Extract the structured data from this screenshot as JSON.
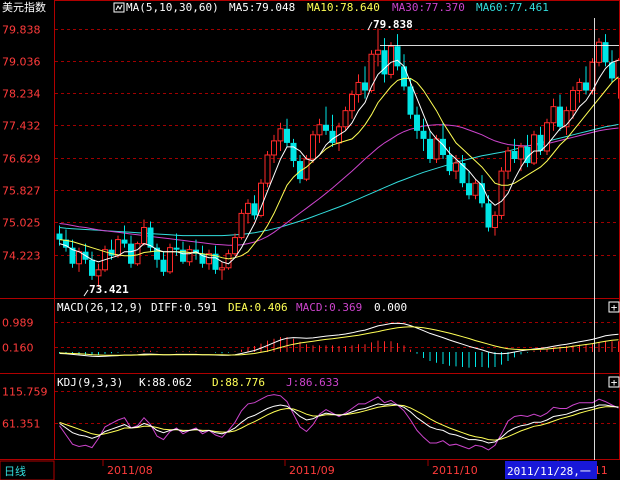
{
  "header": {
    "title": "美元指数",
    "ma_params": "MA(5,10,30,60)",
    "ma5": "MA5:79.048",
    "ma10": "MA10:78.640",
    "ma30": "MA30:77.370",
    "ma60": "MA60:77.461"
  },
  "macd_header": {
    "params": "MACD(26,12,9)",
    "diff": "DIFF:0.591",
    "dea": "DEA:0.406",
    "macd": "MACD:0.369",
    "extra": "0.000"
  },
  "kdj_header": {
    "params": "KDJ(9,3,3)",
    "k": "K:88.062",
    "d": "D:88.776",
    "j": "J:86.633"
  },
  "period_tab": "日线",
  "cursor_date": "2011/11/28,一",
  "price_high_label": "79.838",
  "price_low_label": "73.421",
  "price_axis": [
    "79.838",
    "79.036",
    "78.234",
    "77.432",
    "76.629",
    "75.827",
    "75.025",
    "74.223"
  ],
  "macd_axis": [
    "0.989",
    "0.160"
  ],
  "kdj_axis": [
    "115.759",
    "61.351"
  ],
  "date_axis": [
    "2011/08",
    "2011/09",
    "2011/10",
    "2011/11"
  ],
  "colors": {
    "up": "#ff2a2a",
    "down": "#00e5e5",
    "ma5": "#ffffff",
    "ma10": "#ffff55",
    "ma30": "#cc44cc",
    "ma60": "#33dddd",
    "grid": "#a00000",
    "axis_text": "#ff3b3b"
  },
  "chart_data": {
    "type": "candlestick",
    "ylim": [
      73.2,
      80.1
    ],
    "candles": [
      [
        74.75,
        74.95,
        74.45,
        74.6
      ],
      [
        74.6,
        74.85,
        74.3,
        74.4
      ],
      [
        74.4,
        74.6,
        73.9,
        74.0
      ],
      [
        74.0,
        74.4,
        73.8,
        74.3
      ],
      [
        74.3,
        74.5,
        74.0,
        74.1
      ],
      [
        74.1,
        74.3,
        73.6,
        73.7
      ],
      [
        73.7,
        74.0,
        73.42,
        73.85
      ],
      [
        73.85,
        74.45,
        73.8,
        74.35
      ],
      [
        74.35,
        74.6,
        74.1,
        74.2
      ],
      [
        74.2,
        74.7,
        74.15,
        74.6
      ],
      [
        74.6,
        74.95,
        74.4,
        74.5
      ],
      [
        74.5,
        74.7,
        73.9,
        74.0
      ],
      [
        74.0,
        74.55,
        73.95,
        74.5
      ],
      [
        74.5,
        75.1,
        74.45,
        74.9
      ],
      [
        74.9,
        75.05,
        74.3,
        74.4
      ],
      [
        74.4,
        74.5,
        73.9,
        74.1
      ],
      [
        74.1,
        74.3,
        73.7,
        73.8
      ],
      [
        73.8,
        74.5,
        73.75,
        74.4
      ],
      [
        74.4,
        74.75,
        74.2,
        74.35
      ],
      [
        74.35,
        74.55,
        74.0,
        74.05
      ],
      [
        74.05,
        74.45,
        73.95,
        74.35
      ],
      [
        74.35,
        74.6,
        74.1,
        74.25
      ],
      [
        74.25,
        74.45,
        73.9,
        74.0
      ],
      [
        74.0,
        74.35,
        73.85,
        74.25
      ],
      [
        74.25,
        74.45,
        73.75,
        73.85
      ],
      [
        73.85,
        74.05,
        73.6,
        73.9
      ],
      [
        73.9,
        74.35,
        73.85,
        74.25
      ],
      [
        74.25,
        74.75,
        74.2,
        74.65
      ],
      [
        74.65,
        75.35,
        74.6,
        75.25
      ],
      [
        75.25,
        75.6,
        75.0,
        75.5
      ],
      [
        75.5,
        75.7,
        75.1,
        75.2
      ],
      [
        75.2,
        76.1,
        75.15,
        76.0
      ],
      [
        76.0,
        76.8,
        75.9,
        76.7
      ],
      [
        76.7,
        77.2,
        76.5,
        77.05
      ],
      [
        77.05,
        77.5,
        76.8,
        77.35
      ],
      [
        77.35,
        77.6,
        76.9,
        77.0
      ],
      [
        77.0,
        77.1,
        76.4,
        76.55
      ],
      [
        76.55,
        76.7,
        76.0,
        76.1
      ],
      [
        76.1,
        76.7,
        76.05,
        76.6
      ],
      [
        76.6,
        77.3,
        76.5,
        77.2
      ],
      [
        77.2,
        77.6,
        77.0,
        77.45
      ],
      [
        77.45,
        77.9,
        77.2,
        77.3
      ],
      [
        77.3,
        77.7,
        76.9,
        77.0
      ],
      [
        77.0,
        77.5,
        76.8,
        77.4
      ],
      [
        77.4,
        77.9,
        77.3,
        77.8
      ],
      [
        77.8,
        78.3,
        77.6,
        78.2
      ],
      [
        78.2,
        78.7,
        78.0,
        78.5
      ],
      [
        78.5,
        78.9,
        78.1,
        78.3
      ],
      [
        78.3,
        79.3,
        78.25,
        79.2
      ],
      [
        79.2,
        79.84,
        78.9,
        79.3
      ],
      [
        79.3,
        79.6,
        78.5,
        78.7
      ],
      [
        78.7,
        79.5,
        78.6,
        79.4
      ],
      [
        79.4,
        79.7,
        78.8,
        78.9
      ],
      [
        78.9,
        79.2,
        78.3,
        78.4
      ],
      [
        78.4,
        78.6,
        77.6,
        77.7
      ],
      [
        77.7,
        77.9,
        77.1,
        77.3
      ],
      [
        77.3,
        77.6,
        76.8,
        77.1
      ],
      [
        77.1,
        77.3,
        76.5,
        76.6
      ],
      [
        76.6,
        77.2,
        76.5,
        77.1
      ],
      [
        77.1,
        77.5,
        76.6,
        76.7
      ],
      [
        76.7,
        76.9,
        76.2,
        76.3
      ],
      [
        76.3,
        76.7,
        76.1,
        76.5
      ],
      [
        76.5,
        76.7,
        75.9,
        76.0
      ],
      [
        76.0,
        76.3,
        75.6,
        75.7
      ],
      [
        75.7,
        76.1,
        75.6,
        76.0
      ],
      [
        76.0,
        76.2,
        75.4,
        75.5
      ],
      [
        75.5,
        75.7,
        74.8,
        74.9
      ],
      [
        74.9,
        75.3,
        74.7,
        75.2
      ],
      [
        75.2,
        76.4,
        75.1,
        76.3
      ],
      [
        76.3,
        76.9,
        76.1,
        76.8
      ],
      [
        76.8,
        77.1,
        76.5,
        76.6
      ],
      [
        76.6,
        77.0,
        76.3,
        76.9
      ],
      [
        76.9,
        77.2,
        76.4,
        76.5
      ],
      [
        76.5,
        77.3,
        76.45,
        77.2
      ],
      [
        77.2,
        77.4,
        76.7,
        76.8
      ],
      [
        76.8,
        77.6,
        76.7,
        77.5
      ],
      [
        77.5,
        78.1,
        77.3,
        77.9
      ],
      [
        77.9,
        78.2,
        77.3,
        77.4
      ],
      [
        77.4,
        77.9,
        77.2,
        77.8
      ],
      [
        77.8,
        78.4,
        77.6,
        78.3
      ],
      [
        78.3,
        78.6,
        78.0,
        78.5
      ],
      [
        78.5,
        78.9,
        78.2,
        78.3
      ],
      [
        78.3,
        79.1,
        78.2,
        79.0
      ],
      [
        79.0,
        79.6,
        78.9,
        79.5
      ],
      [
        79.5,
        79.7,
        78.9,
        79.0
      ],
      [
        79.0,
        79.3,
        78.5,
        78.6
      ],
      [
        78.6,
        79.1,
        78.1,
        79.05
      ]
    ],
    "ma5": [
      74.5,
      74.45,
      74.35,
      74.3,
      74.2,
      74.1,
      74.05,
      74.1,
      74.15,
      74.2,
      74.3,
      74.3,
      74.35,
      74.5,
      74.45,
      74.35,
      74.3,
      74.3,
      74.3,
      74.25,
      74.25,
      74.3,
      74.2,
      74.15,
      74.15,
      74.05,
      74.0,
      74.15,
      74.4,
      74.7,
      75.0,
      75.4,
      75.8,
      76.2,
      76.6,
      76.9,
      76.9,
      76.8,
      76.6,
      76.55,
      76.7,
      76.95,
      77.1,
      77.2,
      77.3,
      77.5,
      77.8,
      78.0,
      78.4,
      78.7,
      78.85,
      79.0,
      79.05,
      78.9,
      78.5,
      78.1,
      77.7,
      77.3,
      77.1,
      76.95,
      76.75,
      76.6,
      76.45,
      76.3,
      76.1,
      75.95,
      75.6,
      75.45,
      75.55,
      75.75,
      76.1,
      76.4,
      76.65,
      76.8,
      76.8,
      76.95,
      77.15,
      77.35,
      77.45,
      77.65,
      77.9,
      78.05,
      78.3,
      78.6,
      78.85,
      79.0,
      79.05
    ],
    "ma10": [
      74.6,
      74.58,
      74.55,
      74.5,
      74.45,
      74.4,
      74.35,
      74.3,
      74.25,
      74.22,
      74.2,
      74.2,
      74.22,
      74.28,
      74.3,
      74.32,
      74.3,
      74.3,
      74.3,
      74.3,
      74.28,
      74.27,
      74.25,
      74.22,
      74.2,
      74.15,
      74.12,
      74.15,
      74.2,
      74.3,
      74.5,
      74.7,
      74.95,
      75.25,
      75.6,
      75.95,
      76.15,
      76.3,
      76.4,
      76.55,
      76.7,
      76.85,
      76.95,
      77.0,
      77.05,
      77.1,
      77.25,
      77.45,
      77.7,
      78.0,
      78.2,
      78.4,
      78.55,
      78.6,
      78.6,
      78.5,
      78.3,
      78.05,
      77.8,
      77.5,
      77.25,
      77.0,
      76.85,
      76.7,
      76.55,
      76.4,
      76.2,
      76.0,
      75.95,
      75.95,
      76.0,
      76.1,
      76.2,
      76.3,
      76.4,
      76.55,
      76.75,
      76.95,
      77.1,
      77.3,
      77.5,
      77.7,
      77.9,
      78.1,
      78.3,
      78.5,
      78.64
    ],
    "ma30": [
      75.0,
      74.98,
      74.95,
      74.92,
      74.9,
      74.87,
      74.84,
      74.82,
      74.8,
      74.78,
      74.76,
      74.74,
      74.72,
      74.7,
      74.68,
      74.66,
      74.64,
      74.62,
      74.6,
      74.58,
      74.56,
      74.54,
      74.52,
      74.5,
      74.48,
      74.47,
      74.46,
      74.46,
      74.47,
      74.5,
      74.54,
      74.6,
      74.68,
      74.78,
      74.9,
      75.02,
      75.14,
      75.26,
      75.38,
      75.5,
      75.62,
      75.75,
      75.88,
      76.02,
      76.16,
      76.3,
      76.45,
      76.6,
      76.74,
      76.88,
      77.0,
      77.1,
      77.2,
      77.28,
      77.34,
      77.38,
      77.42,
      77.44,
      77.45,
      77.45,
      77.44,
      77.42,
      77.38,
      77.32,
      77.26,
      77.2,
      77.12,
      77.05,
      77.0,
      76.96,
      76.94,
      76.93,
      76.93,
      76.94,
      76.96,
      76.98,
      77.02,
      77.06,
      77.1,
      77.14,
      77.18,
      77.22,
      77.26,
      77.3,
      77.33,
      77.35,
      77.37
    ],
    "ma60": [
      74.9,
      74.88,
      74.87,
      74.86,
      74.85,
      74.84,
      74.83,
      74.82,
      74.81,
      74.8,
      74.79,
      74.78,
      74.77,
      74.76,
      74.75,
      74.74,
      74.73,
      74.72,
      74.71,
      74.7,
      74.7,
      74.7,
      74.7,
      74.7,
      74.7,
      74.7,
      74.71,
      74.72,
      74.73,
      74.75,
      74.77,
      74.8,
      74.83,
      74.87,
      74.91,
      74.96,
      75.01,
      75.06,
      75.11,
      75.17,
      75.23,
      75.29,
      75.35,
      75.41,
      75.47,
      75.54,
      75.61,
      75.68,
      75.75,
      75.82,
      75.89,
      75.96,
      76.03,
      76.09,
      76.15,
      76.21,
      76.27,
      76.32,
      76.37,
      76.42,
      76.47,
      76.52,
      76.56,
      76.6,
      76.64,
      76.68,
      76.71,
      76.74,
      76.77,
      76.8,
      76.84,
      76.88,
      76.92,
      76.96,
      77.0,
      77.04,
      77.08,
      77.12,
      77.16,
      77.2,
      77.24,
      77.28,
      77.32,
      77.36,
      77.4,
      77.43,
      77.46
    ],
    "macd_ylim": [
      -0.6,
      1.2
    ],
    "diff": [
      -0.05,
      -0.06,
      -0.08,
      -0.1,
      -0.12,
      -0.14,
      -0.15,
      -0.14,
      -0.13,
      -0.12,
      -0.1,
      -0.1,
      -0.09,
      -0.07,
      -0.07,
      -0.08,
      -0.09,
      -0.09,
      -0.08,
      -0.08,
      -0.08,
      -0.08,
      -0.09,
      -0.09,
      -0.1,
      -0.11,
      -0.11,
      -0.09,
      -0.05,
      0.0,
      0.05,
      0.13,
      0.22,
      0.31,
      0.4,
      0.46,
      0.48,
      0.47,
      0.46,
      0.47,
      0.5,
      0.53,
      0.55,
      0.57,
      0.6,
      0.64,
      0.69,
      0.73,
      0.8,
      0.87,
      0.91,
      0.95,
      0.96,
      0.94,
      0.88,
      0.8,
      0.71,
      0.62,
      0.55,
      0.48,
      0.4,
      0.33,
      0.26,
      0.19,
      0.13,
      0.07,
      0.0,
      -0.05,
      -0.06,
      -0.04,
      0.0,
      0.04,
      0.07,
      0.1,
      0.12,
      0.15,
      0.19,
      0.23,
      0.26,
      0.3,
      0.34,
      0.38,
      0.42,
      0.48,
      0.54,
      0.57,
      0.59
    ],
    "dea": [
      -0.03,
      -0.04,
      -0.05,
      -0.06,
      -0.07,
      -0.09,
      -0.1,
      -0.11,
      -0.11,
      -0.11,
      -0.11,
      -0.11,
      -0.1,
      -0.1,
      -0.09,
      -0.09,
      -0.09,
      -0.09,
      -0.09,
      -0.09,
      -0.09,
      -0.09,
      -0.09,
      -0.09,
      -0.09,
      -0.09,
      -0.1,
      -0.1,
      -0.09,
      -0.07,
      -0.05,
      -0.01,
      0.03,
      0.09,
      0.15,
      0.21,
      0.26,
      0.3,
      0.33,
      0.36,
      0.39,
      0.42,
      0.44,
      0.47,
      0.5,
      0.53,
      0.56,
      0.6,
      0.64,
      0.68,
      0.73,
      0.77,
      0.81,
      0.83,
      0.84,
      0.83,
      0.81,
      0.77,
      0.73,
      0.68,
      0.63,
      0.57,
      0.51,
      0.45,
      0.38,
      0.32,
      0.26,
      0.2,
      0.15,
      0.11,
      0.09,
      0.08,
      0.08,
      0.08,
      0.09,
      0.1,
      0.12,
      0.14,
      0.16,
      0.19,
      0.22,
      0.25,
      0.28,
      0.32,
      0.36,
      0.39,
      0.41
    ],
    "kdj_ylim": [
      0,
      125
    ],
    "k": [
      60,
      52,
      44,
      40,
      38,
      34,
      38,
      46,
      50,
      54,
      58,
      52,
      54,
      60,
      56,
      48,
      44,
      48,
      50,
      46,
      48,
      50,
      46,
      48,
      44,
      42,
      46,
      52,
      62,
      70,
      74,
      80,
      86,
      90,
      92,
      90,
      82,
      72,
      66,
      68,
      74,
      78,
      76,
      74,
      76,
      80,
      84,
      86,
      90,
      94,
      92,
      94,
      92,
      88,
      80,
      70,
      62,
      54,
      50,
      48,
      42,
      40,
      36,
      32,
      32,
      30,
      26,
      28,
      36,
      46,
      52,
      56,
      58,
      62,
      62,
      66,
      72,
      74,
      76,
      80,
      84,
      86,
      88,
      92,
      92,
      90,
      88
    ],
    "d": [
      62,
      58,
      54,
      50,
      46,
      42,
      40,
      42,
      45,
      48,
      52,
      52,
      53,
      55,
      55,
      53,
      50,
      49,
      49,
      48,
      48,
      49,
      48,
      48,
      46,
      45,
      45,
      47,
      52,
      58,
      63,
      69,
      75,
      80,
      84,
      86,
      85,
      81,
      76,
      73,
      73,
      75,
      75,
      75,
      75,
      77,
      79,
      82,
      85,
      88,
      90,
      91,
      92,
      91,
      87,
      81,
      75,
      68,
      62,
      57,
      52,
      48,
      44,
      40,
      37,
      35,
      32,
      31,
      33,
      37,
      42,
      47,
      51,
      55,
      57,
      60,
      64,
      68,
      71,
      74,
      78,
      81,
      84,
      87,
      89,
      89,
      88.8
    ],
    "j": [
      56,
      40,
      24,
      20,
      22,
      18,
      34,
      54,
      60,
      66,
      70,
      52,
      56,
      70,
      58,
      38,
      32,
      46,
      52,
      42,
      48,
      52,
      42,
      48,
      40,
      36,
      48,
      62,
      82,
      94,
      96,
      102,
      108,
      110,
      108,
      98,
      76,
      54,
      46,
      58,
      76,
      84,
      78,
      72,
      78,
      86,
      94,
      94,
      100,
      106,
      96,
      100,
      92,
      82,
      66,
      48,
      36,
      26,
      26,
      30,
      22,
      24,
      20,
      16,
      22,
      20,
      14,
      22,
      42,
      64,
      72,
      74,
      72,
      76,
      72,
      78,
      88,
      86,
      86,
      92,
      96,
      96,
      96,
      102,
      98,
      92,
      86.6
    ]
  }
}
